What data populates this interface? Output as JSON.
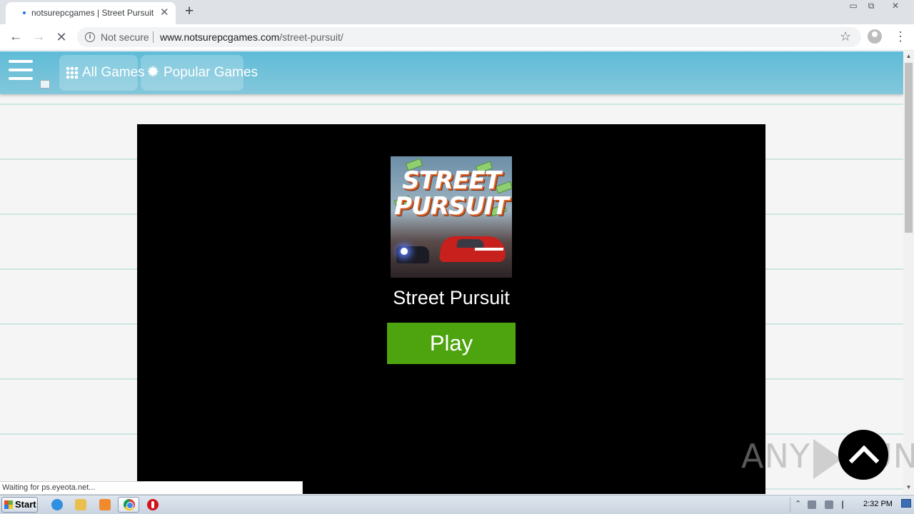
{
  "browser": {
    "tab_title": "notsurepcgames | Street Pursuit",
    "tab_close": "✕",
    "new_tab": "+",
    "nav_back": "←",
    "nav_forward": "→",
    "nav_stop": "✕",
    "security_label": "Not secure",
    "url_host": "www.notsurepcgames.com",
    "url_path": "/street-pursuit/",
    "star": "☆",
    "menu": "⋮",
    "window_controls": {
      "minimize": "▭",
      "restore": "⧉",
      "close": "✕"
    }
  },
  "site": {
    "nav": [
      {
        "label": "All Games",
        "icon": "grid-icon"
      },
      {
        "label": "Popular Games",
        "icon": "burst-icon"
      }
    ]
  },
  "game": {
    "cover_line1": "STREET",
    "cover_line2": "PURSUIT",
    "title": "Street Pursuit",
    "play_label": "Play"
  },
  "status_bar": "Waiting for ps.eyeota.net...",
  "watermark": {
    "left": "ANY",
    "right": "RUN"
  },
  "taskbar": {
    "start_label": "Start",
    "tray_arrow": "⌃",
    "clock": "2:32 PM"
  },
  "colors": {
    "site_bar": "#5fbcd8",
    "play_button": "#4ea40f",
    "game_panel": "#000000"
  }
}
